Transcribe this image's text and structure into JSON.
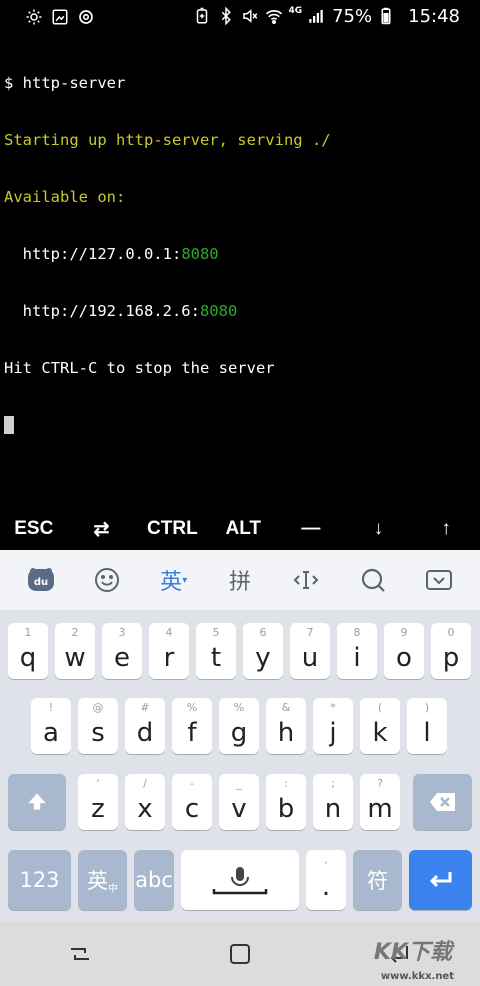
{
  "status_bar": {
    "left_icons": [
      "brightness-icon",
      "photo-icon",
      "sync-icon"
    ],
    "right_icons": [
      "battery-saver-icon",
      "bluetooth-icon",
      "mute-icon",
      "wifi-icon",
      "signal-icon",
      "battery-icon"
    ],
    "network": "4G",
    "battery": "75%",
    "time": "15:48"
  },
  "terminal": {
    "lines": [
      {
        "segments": [
          {
            "text": "$ http-server",
            "color": "#ffffff"
          }
        ]
      },
      {
        "segments": [
          {
            "text": "Starting up http-server, serving ./",
            "color": "#c9c92a"
          }
        ]
      },
      {
        "segments": [
          {
            "text": "Available on:",
            "color": "#c9c92a"
          }
        ]
      },
      {
        "segments": [
          {
            "text": "  http://127.0.0.1:",
            "color": "#ffffff"
          },
          {
            "text": "8080",
            "color": "#2ea82e"
          }
        ]
      },
      {
        "segments": [
          {
            "text": "  http://192.168.2.6:",
            "color": "#ffffff"
          },
          {
            "text": "8080",
            "color": "#2ea82e"
          }
        ]
      },
      {
        "segments": [
          {
            "text": "Hit CTRL-C to stop the server",
            "color": "#ffffff"
          }
        ]
      }
    ]
  },
  "extra_keys": [
    "ESC",
    "⇄",
    "CTRL",
    "ALT",
    "—",
    "↓",
    "↑"
  ],
  "ime_toolbar": {
    "lang_label": "英",
    "pinyin_label": "拼"
  },
  "keyboard": {
    "row1": [
      {
        "key": "q",
        "sub": "1"
      },
      {
        "key": "w",
        "sub": "2"
      },
      {
        "key": "e",
        "sub": "3"
      },
      {
        "key": "r",
        "sub": "4"
      },
      {
        "key": "t",
        "sub": "5"
      },
      {
        "key": "y",
        "sub": "6"
      },
      {
        "key": "u",
        "sub": "7"
      },
      {
        "key": "i",
        "sub": "8"
      },
      {
        "key": "o",
        "sub": "9"
      },
      {
        "key": "p",
        "sub": "0"
      }
    ],
    "row2": [
      {
        "key": "a",
        "sub": "!"
      },
      {
        "key": "s",
        "sub": "@"
      },
      {
        "key": "d",
        "sub": "#"
      },
      {
        "key": "f",
        "sub": "%"
      },
      {
        "key": "g",
        "sub": "%"
      },
      {
        "key": "h",
        "sub": "&"
      },
      {
        "key": "j",
        "sub": "*"
      },
      {
        "key": "k",
        "sub": "("
      },
      {
        "key": "l",
        "sub": ")"
      }
    ],
    "row3": [
      {
        "key": "z",
        "sub": "'"
      },
      {
        "key": "x",
        "sub": "/"
      },
      {
        "key": "c",
        "sub": "-"
      },
      {
        "key": "v",
        "sub": "_"
      },
      {
        "key": "b",
        "sub": ":"
      },
      {
        "key": "n",
        "sub": ";"
      },
      {
        "key": "m",
        "sub": "?"
      }
    ],
    "row4": {
      "num": "123",
      "lang": "英",
      "lang_sub": "中",
      "abc": "abc",
      "comma_sub": ",",
      "period": ".",
      "symbol": "符"
    }
  },
  "watermark": {
    "logo": "KK下载",
    "site": "www.kkx.net"
  }
}
